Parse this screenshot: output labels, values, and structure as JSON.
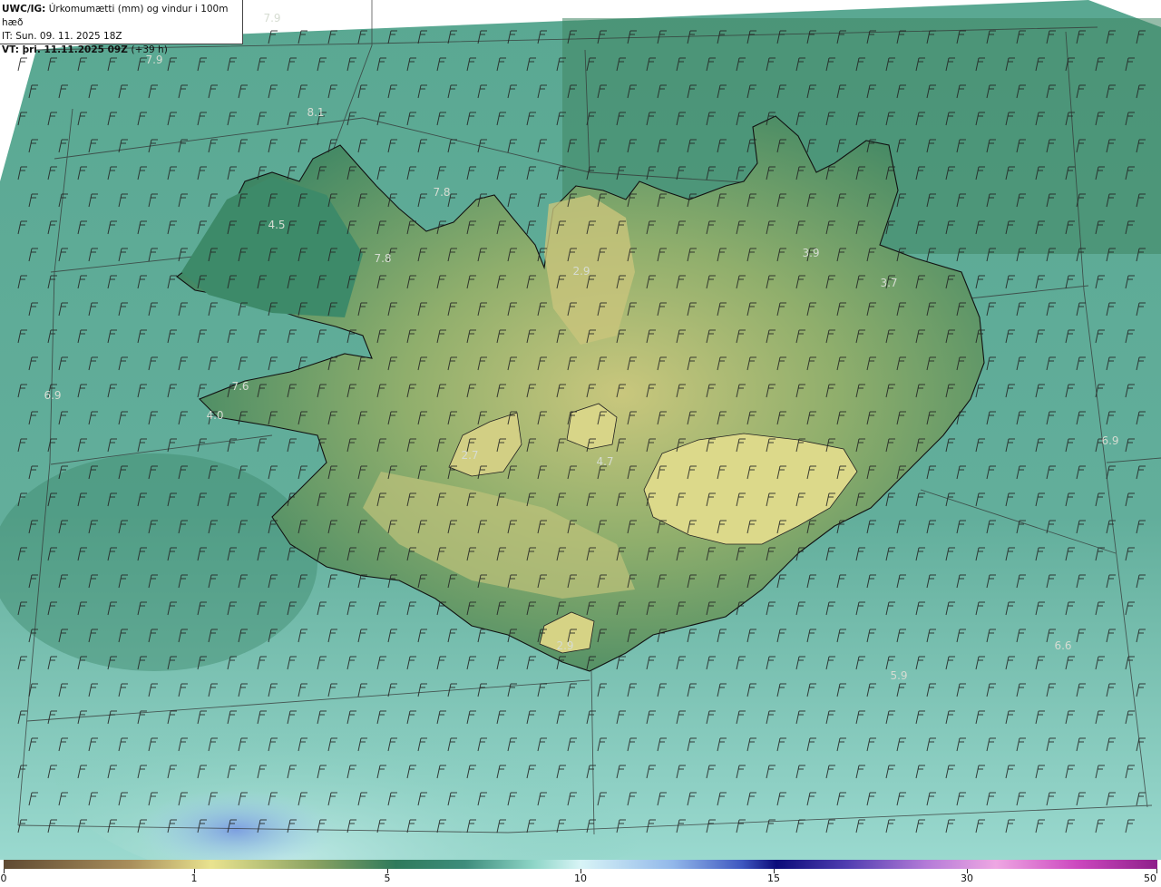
{
  "header": {
    "model": "UWC/IG:",
    "title": "Úrkomumætti (mm) og vindur i 100m hæð",
    "initial_time": "IT: Sun. 09. 11. 2025 18Z",
    "valid_time": "VT: þri. 11.11.2025 09Z",
    "lead_time": "(+39 h)"
  },
  "colorbar": {
    "labels": [
      "0",
      "1",
      "5",
      "10",
      "15",
      "30",
      "50"
    ],
    "colors": [
      "#5f4a32",
      "#e9e38f",
      "#2f7a5c",
      "#d8f4f6",
      "#0b0b7a",
      "#eea7e3",
      "#8e1f8a"
    ]
  },
  "value_labels": [
    "7.9",
    "7.9",
    "8.1",
    "7.8",
    "4.5",
    "7.8",
    "2.9",
    "3.9",
    "3.7",
    "6.9",
    "7.6",
    "4.0",
    "2.7",
    "4.7",
    "6.9",
    "6.6",
    "5.9",
    "2.9"
  ],
  "colors": {
    "sea": "#6fbfae",
    "land_low": "#2f7a5c",
    "land_high": "#c8c77e",
    "coast": "#111111",
    "barb": "#222222",
    "label": "#d6dcd2"
  }
}
